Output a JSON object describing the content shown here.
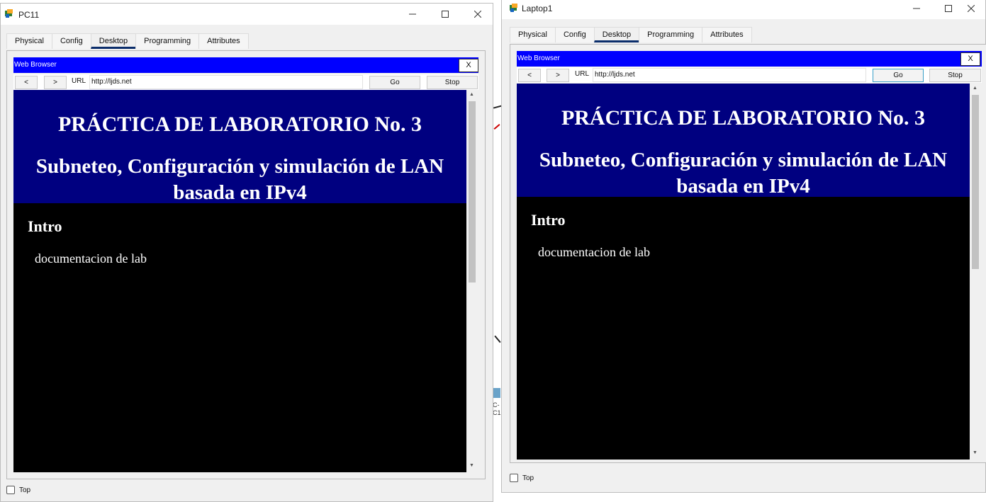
{
  "background": {
    "label_a": "C-",
    "label_b": "C1"
  },
  "windows": [
    {
      "id": "pc11",
      "title": "PC11",
      "tabs": [
        "Physical",
        "Config",
        "Desktop",
        "Programming",
        "Attributes"
      ],
      "active_tab": "Desktop",
      "browser": {
        "title": "Web Browser",
        "close_label": "X",
        "back_label": "<",
        "forward_label": ">",
        "url_label": "URL",
        "url_value": "http://ljds.net",
        "go_label": "Go",
        "stop_label": "Stop",
        "page": {
          "heading": "PRÁCTICA DE LABORATORIO No. 3",
          "subheading": "Subneteo, Configuración y simulación de LAN basada en IPv4",
          "section_title": "Intro",
          "body_text": "documentacion de lab"
        }
      },
      "top_checkbox_label": "Top",
      "top_checked": false
    },
    {
      "id": "laptop1",
      "title": "Laptop1",
      "tabs": [
        "Physical",
        "Config",
        "Desktop",
        "Programming",
        "Attributes"
      ],
      "active_tab": "Desktop",
      "browser": {
        "title": "Web Browser",
        "close_label": "X",
        "back_label": "<",
        "forward_label": ">",
        "url_label": "URL",
        "url_value": "http://ljds.net",
        "go_label": "Go",
        "stop_label": "Stop",
        "page": {
          "heading": "PRÁCTICA DE LABORATORIO No. 3",
          "subheading": "Subneteo, Configuración y simulación de LAN basada en IPv4",
          "section_title": "Intro",
          "body_text": "documentacion de lab"
        }
      },
      "top_checkbox_label": "Top",
      "top_checked": false
    }
  ],
  "colors": {
    "browser_bar": "#0000ff",
    "page_header": "#000080",
    "page_body": "#000000",
    "active_tab_underline": "#0b2d6b"
  }
}
